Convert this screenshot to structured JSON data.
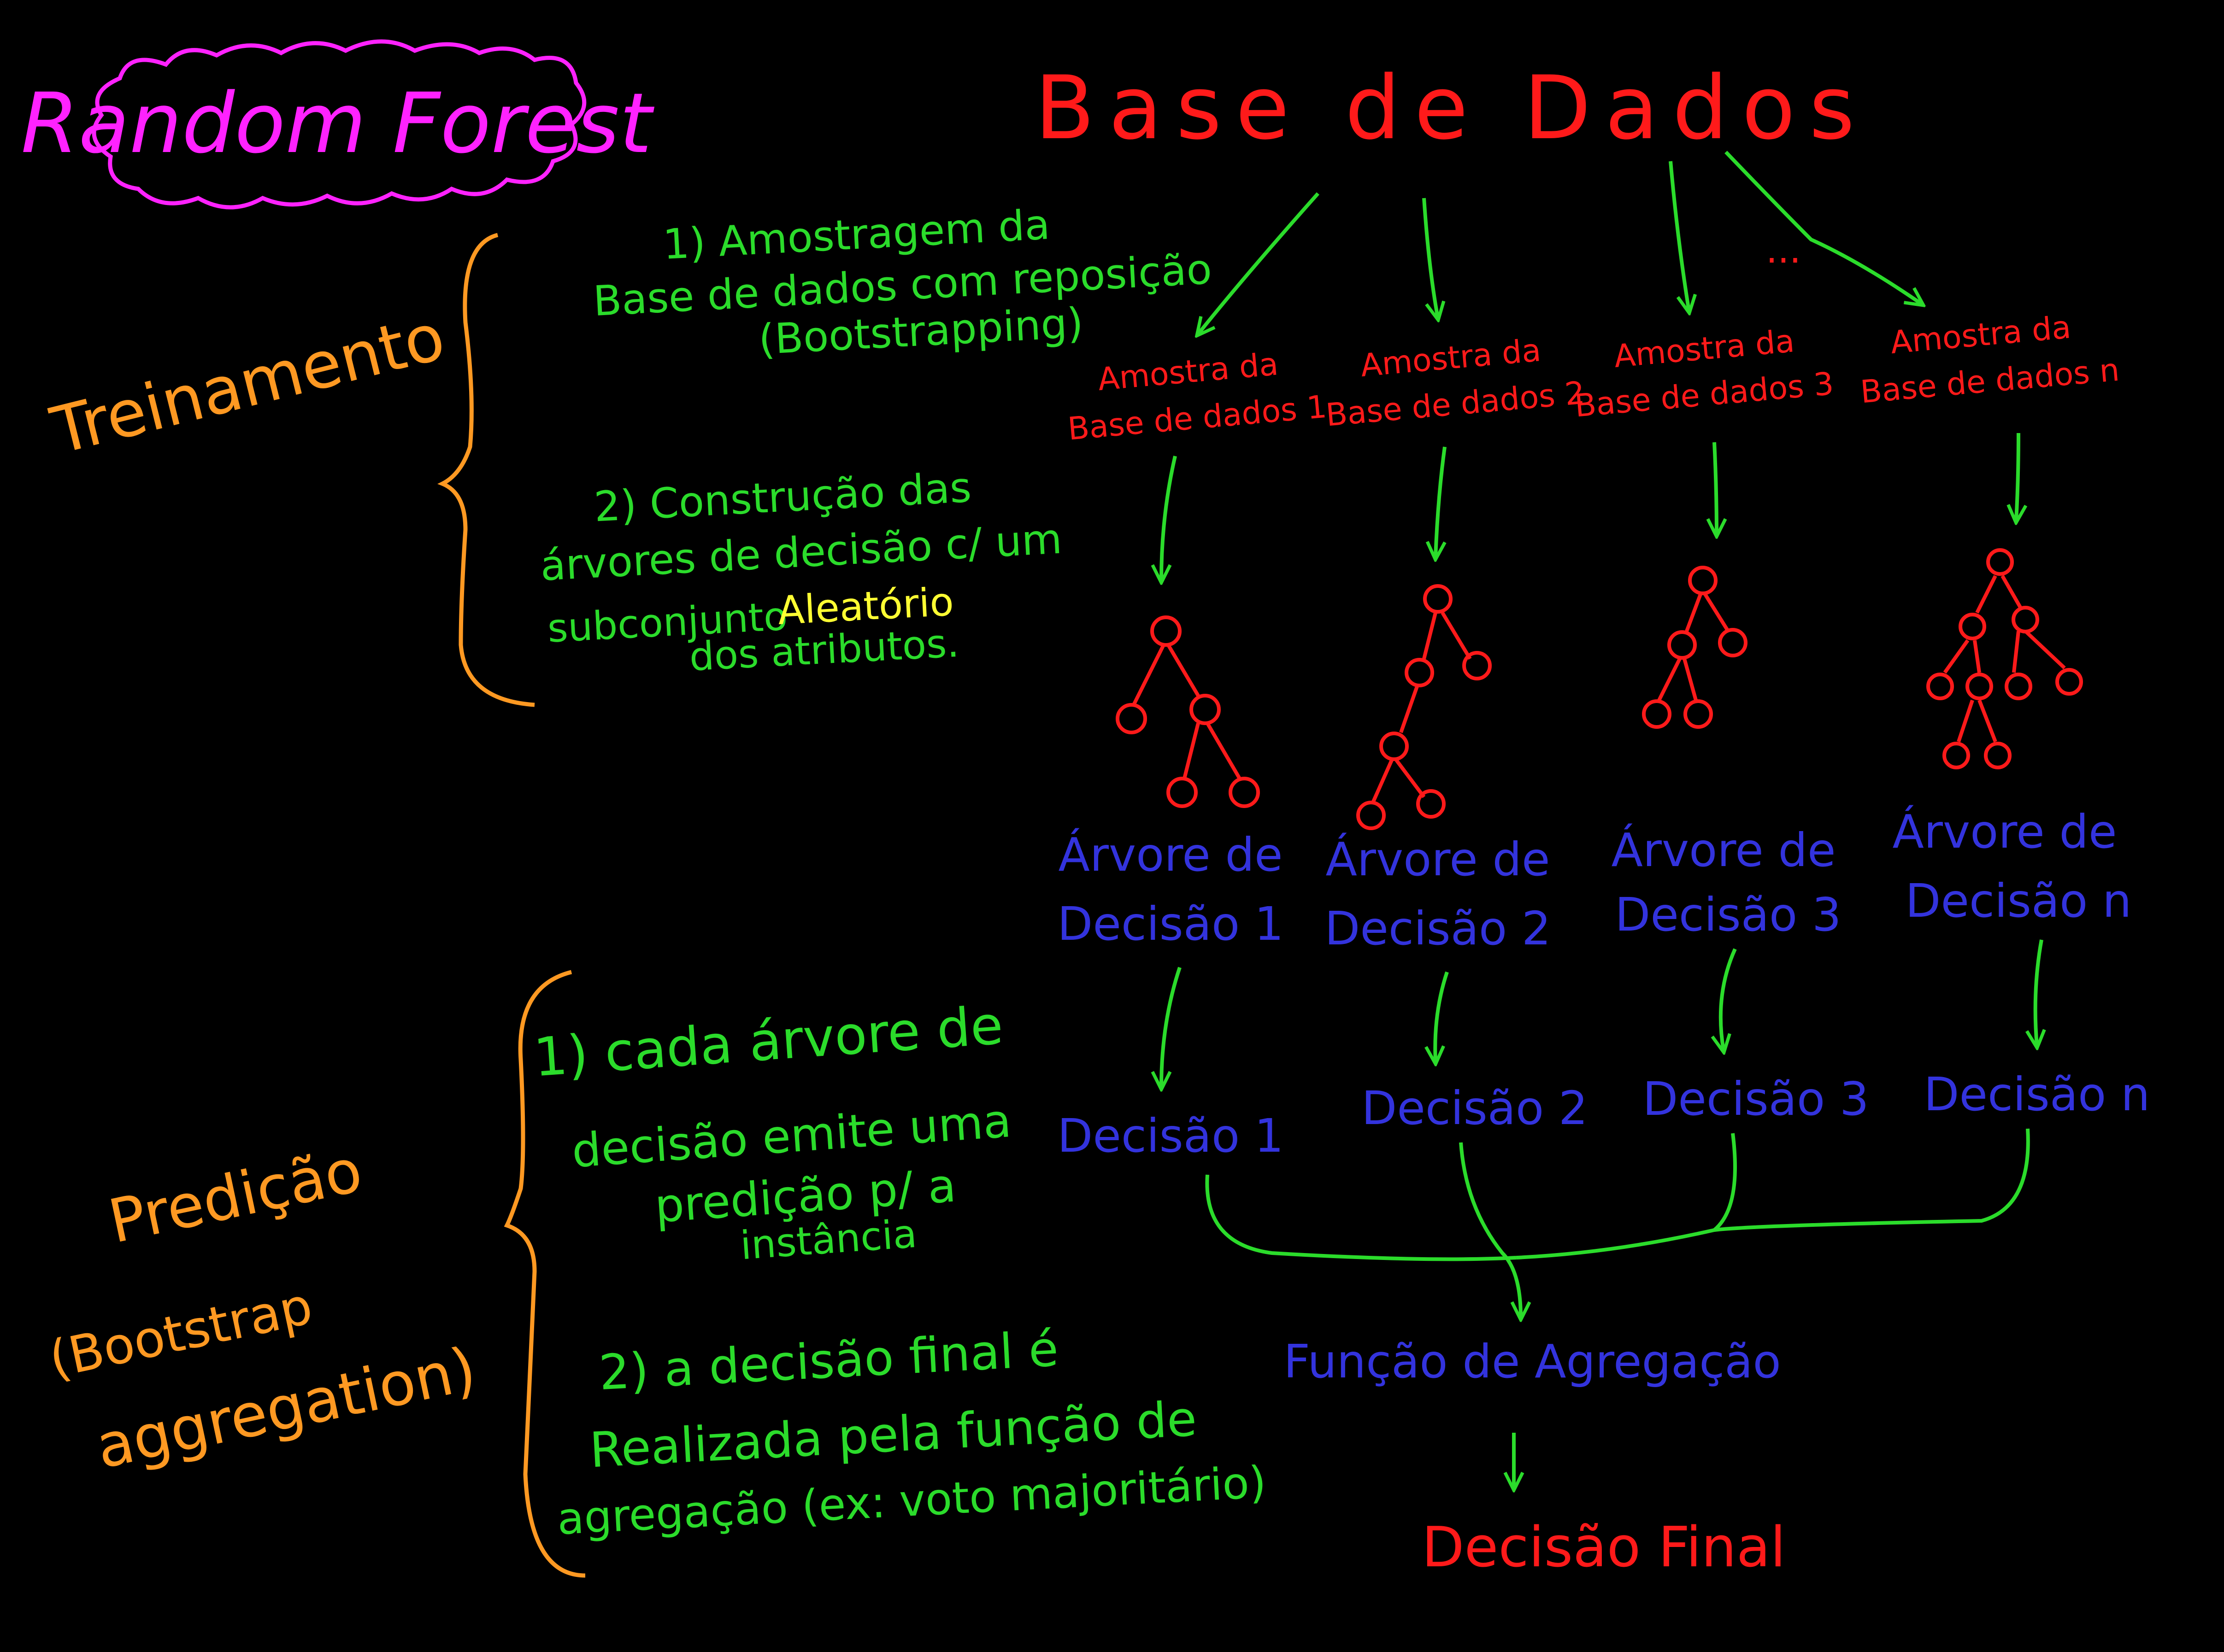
{
  "title": "Random Forest",
  "colors": {
    "background": "#000000",
    "title": "#ff22ff",
    "annotation": "#2bdc2b",
    "highlight": "#ffff33",
    "section": "#ff9922",
    "data": "#ff1a1a",
    "decision": "#3333dd",
    "arrow": "#2bdc2b",
    "brace": "#ff9922"
  },
  "database": "Base de Dados",
  "ellipsis": "...",
  "sections": {
    "training": "Treinamento",
    "prediction": [
      "Predição",
      "(Bootstrap",
      "aggregation)"
    ]
  },
  "training_steps": {
    "step1": [
      "1) Amostragem da",
      "Base de dados com reposição",
      "(Bootstrapping)"
    ],
    "step2": [
      "2) Construção das",
      "árvores de decisão c/ um"
    ],
    "step2_subset_prefix": "subconjunto",
    "step2_highlight": "Aleatório",
    "step2_tail": "dos atributos."
  },
  "prediction_steps": {
    "step1": [
      "1) cada árvore de",
      "decisão emite uma",
      "predição p/ a",
      "instância"
    ],
    "step2": [
      "2) a decisão final é",
      "Realizada pela função de",
      "agregação (ex: voto majoritário)"
    ]
  },
  "columns": [
    {
      "sample": [
        "Amostra da",
        "Base de dados 1"
      ],
      "tree": [
        "Árvore de",
        "Decisão 1"
      ],
      "decision": "Decisão 1"
    },
    {
      "sample": [
        "Amostra da",
        "Base de dados 2"
      ],
      "tree": [
        "Árvore de",
        "Decisão 2"
      ],
      "decision": "Decisão 2"
    },
    {
      "sample": [
        "Amostra da",
        "Base de dados 3"
      ],
      "tree": [
        "Árvore de",
        "Decisão 3"
      ],
      "decision": "Decisão 3"
    },
    {
      "sample": [
        "Amostra da",
        "Base de dados n"
      ],
      "tree": [
        "Árvore de",
        "Decisão n"
      ],
      "decision": "Decisão n"
    }
  ],
  "aggregation": "Função de Agregação",
  "final_decision": "Decisão Final"
}
